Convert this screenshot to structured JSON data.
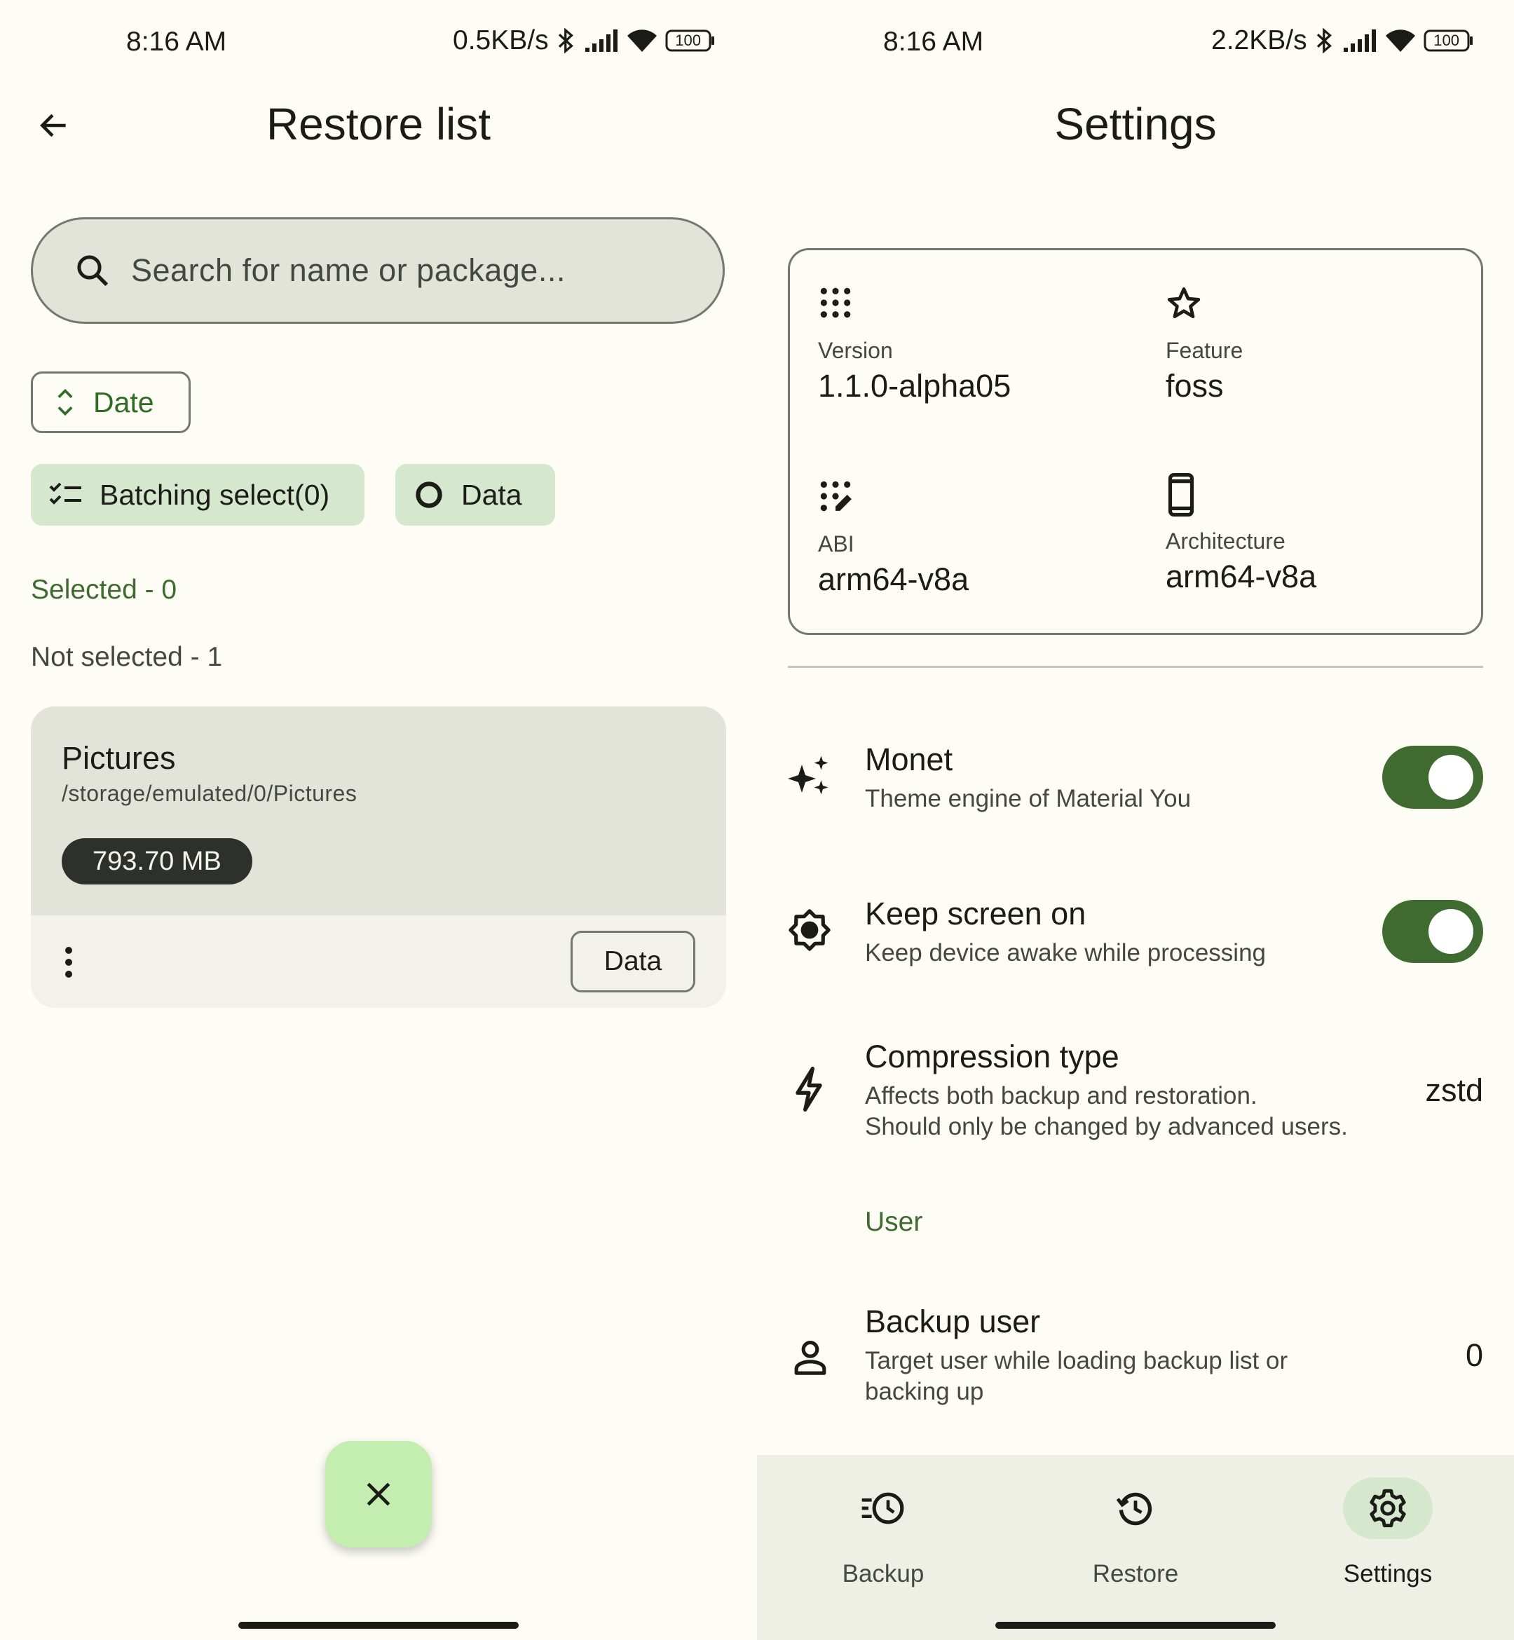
{
  "left": {
    "status": {
      "time": "8:16 AM",
      "speed": "0.5KB/s",
      "battery": "100"
    },
    "title": "Restore list",
    "search": {
      "placeholder": "Search for name or package..."
    },
    "sort_chip": {
      "label": "Date"
    },
    "batch_chip": {
      "label": "Batching select(0)"
    },
    "data_chip": {
      "label": "Data"
    },
    "selected_label": "Selected - 0",
    "not_selected_label": "Not selected - 1",
    "card": {
      "title": "Pictures",
      "path": "/storage/emulated/0/Pictures",
      "size": "793.70 MB",
      "action_label": "Data"
    }
  },
  "right": {
    "status": {
      "time": "8:16 AM",
      "speed": "2.2KB/s",
      "battery": "100"
    },
    "title": "Settings",
    "info": {
      "version_label": "Version",
      "version_value": "1.1.0-alpha05",
      "feature_label": "Feature",
      "feature_value": "foss",
      "abi_label": "ABI",
      "abi_value": "arm64-v8a",
      "arch_label": "Architecture",
      "arch_value": "arm64-v8a"
    },
    "prefs": {
      "monet_title": "Monet",
      "monet_sub": "Theme engine of Material You",
      "monet_on": true,
      "keep_title": "Keep screen on",
      "keep_sub": "Keep device awake while processing",
      "keep_on": true,
      "compression_title": "Compression type",
      "compression_sub1": "Affects both backup and restoration.",
      "compression_sub2": "Should only be changed by advanced users.",
      "compression_value": "zstd",
      "user_header": "User",
      "backup_user_title": "Backup user",
      "backup_user_sub1": "Target user while loading backup list or",
      "backup_user_sub2": "backing up",
      "backup_user_value": "0"
    },
    "nav": {
      "backup": "Backup",
      "restore": "Restore",
      "settings": "Settings",
      "active": "settings"
    }
  },
  "colors": {
    "background": "#fdfdf6",
    "primary": "#3f6a30",
    "primary_container": "#d5e8cd",
    "fab": "#c3eeb0",
    "outline": "#73796c"
  }
}
